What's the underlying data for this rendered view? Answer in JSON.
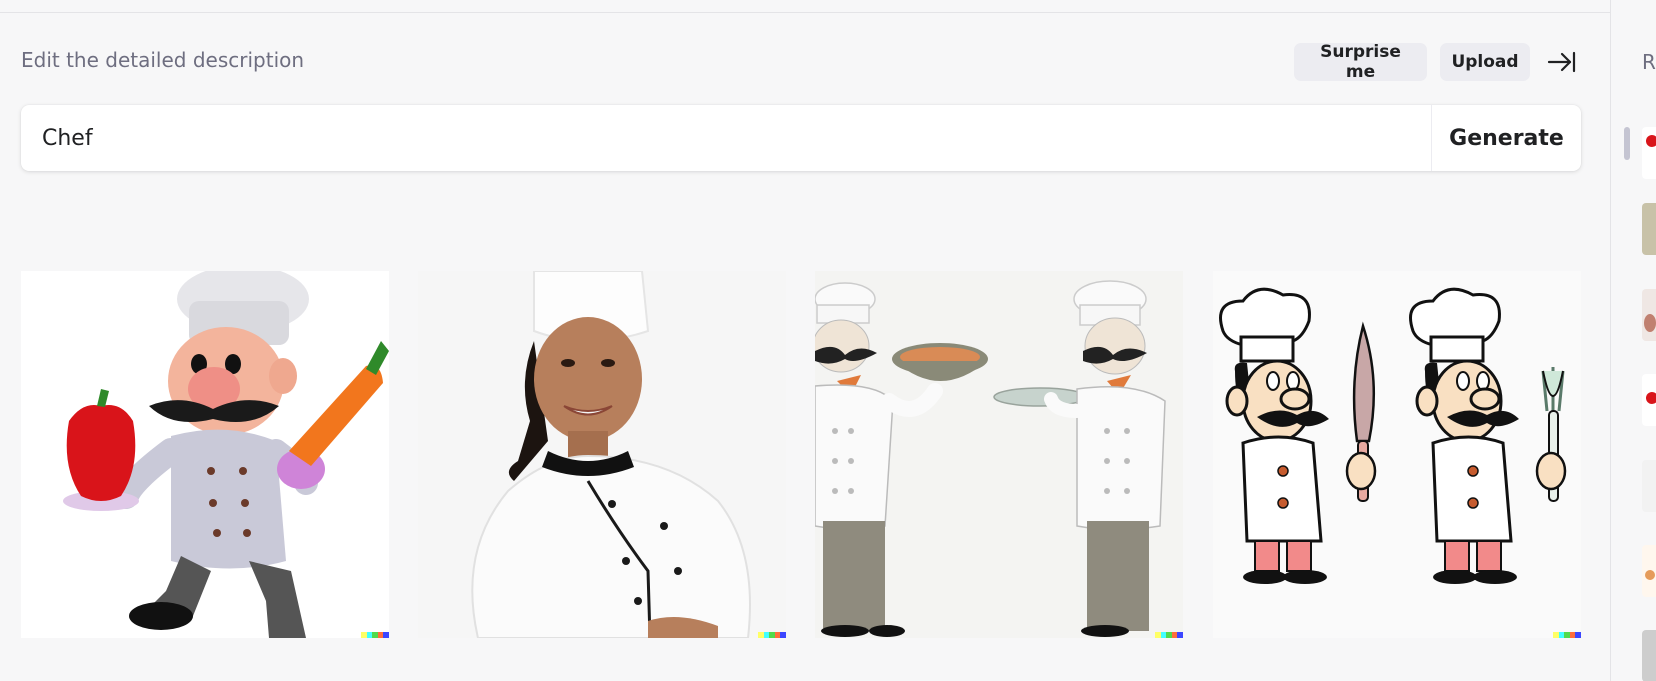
{
  "header": {
    "description_label": "Edit the detailed description",
    "surprise_label": "Surprise me",
    "upload_label": "Upload"
  },
  "prompt": {
    "value": "Chef",
    "generate_label": "Generate"
  },
  "results": [
    {
      "subject": "3D cartoon chef holding red pepper and carrot"
    },
    {
      "subject": "Smiling woman chef in white uniform"
    },
    {
      "subject": "Illustrated mustached chef holding soup bowl and plate"
    },
    {
      "subject": "Cartoon chef with knife and fork"
    }
  ],
  "sidebar": {
    "title": "R",
    "thumbnail_count": 7
  },
  "colors": {
    "background": "#f7f7f8",
    "button_bg": "#ececf1",
    "text": "#202123",
    "muted": "#6e6e80",
    "signature": [
      "#ffff66",
      "#42ffff",
      "#51da4c",
      "#ff6e3c",
      "#3c46ff"
    ]
  }
}
